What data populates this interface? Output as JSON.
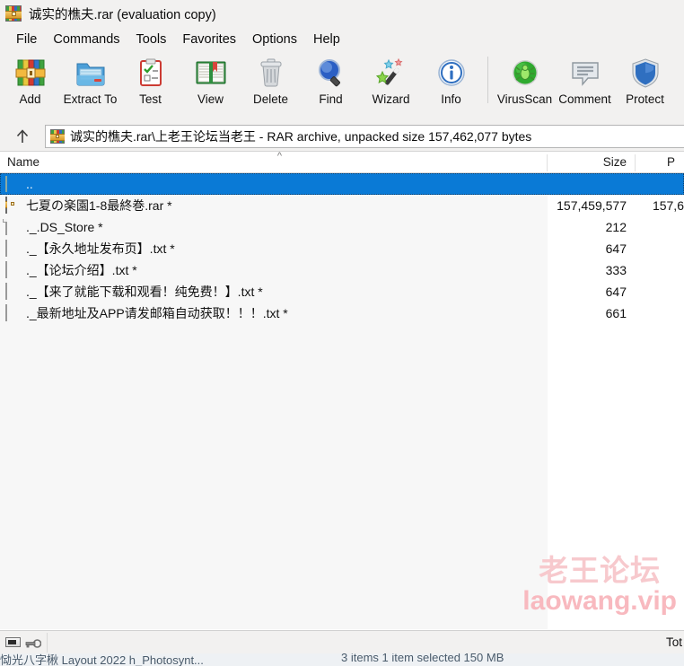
{
  "window": {
    "title": "诚实的樵夫.rar (evaluation copy)",
    "icon": "winrar-books-icon"
  },
  "menu": {
    "items": [
      {
        "label": "File"
      },
      {
        "label": "Commands"
      },
      {
        "label": "Tools"
      },
      {
        "label": "Favorites"
      },
      {
        "label": "Options"
      },
      {
        "label": "Help"
      }
    ]
  },
  "toolbar": {
    "buttons": [
      {
        "label": "Add",
        "icon": "add-archive-icon"
      },
      {
        "label": "Extract To",
        "icon": "extract-folder-icon"
      },
      {
        "label": "Test",
        "icon": "test-clipboard-icon"
      },
      {
        "label": "View",
        "icon": "view-book-icon"
      },
      {
        "label": "Delete",
        "icon": "delete-trash-icon"
      },
      {
        "label": "Find",
        "icon": "find-magnifier-icon"
      },
      {
        "label": "Wizard",
        "icon": "wizard-wand-icon"
      },
      {
        "label": "Info",
        "icon": "info-circle-icon"
      },
      {
        "label": "VirusScan",
        "icon": "virusscan-bug-icon"
      },
      {
        "label": "Comment",
        "icon": "comment-bubble-icon"
      },
      {
        "label": "Protect",
        "icon": "protect-shield-icon"
      }
    ]
  },
  "address": {
    "up_icon": "up-arrow-icon",
    "archive_icon": "winrar-books-icon",
    "path_text": "诚实的樵夫.rar\\上老王论坛当老王 - RAR archive, unpacked size 157,462,077 bytes"
  },
  "listview": {
    "columns": [
      {
        "label": "Name",
        "sort": "ascending"
      },
      {
        "label": "Size"
      },
      {
        "label": "P"
      }
    ],
    "sort_caret": "^",
    "rows": [
      {
        "icon": "folder-icon",
        "name": "..",
        "size": "",
        "packed": "",
        "selected": true
      },
      {
        "icon": "winrar-archive-icon",
        "name": "七夏の楽園1-8最終巻.rar *",
        "size": "157,459,577",
        "packed": "157,6",
        "selected": false
      },
      {
        "icon": "blank-file-icon",
        "name": "._.DS_Store *",
        "size": "212",
        "packed": "",
        "selected": false
      },
      {
        "icon": "text-file-icon",
        "name": "._【永久地址发布页】.txt *",
        "size": "647",
        "packed": "",
        "selected": false
      },
      {
        "icon": "text-file-icon",
        "name": "._【论坛介绍】.txt *",
        "size": "333",
        "packed": "",
        "selected": false
      },
      {
        "icon": "text-file-icon",
        "name": "._【来了就能下载和观看！纯免费！】.txt *",
        "size": "647",
        "packed": "",
        "selected": false
      },
      {
        "icon": "text-file-icon",
        "name": "._最新地址及APP请发邮箱自动获取！！！.txt *",
        "size": "661",
        "packed": "",
        "selected": false
      }
    ]
  },
  "watermark": {
    "line1": "老王论坛",
    "line2": "laowang.vip",
    "color": "#f7c9cd"
  },
  "statusbar": {
    "disk_icon": "disk-icon",
    "key_icon": "key-icon",
    "total_text": "Tot"
  },
  "background_window": {
    "taskbar_items": "恸光八字楸   Layout 2022   h_Photosynt...",
    "explorer_status": "3 items     1 item selected  150 MB"
  }
}
